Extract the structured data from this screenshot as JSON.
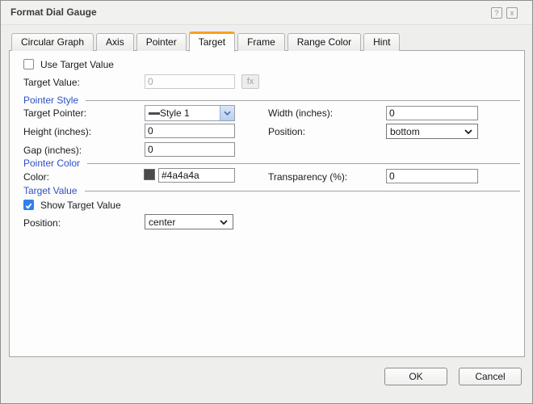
{
  "dialog": {
    "title": "Format Dial Gauge",
    "help_icon": "?",
    "close_icon": "x"
  },
  "tabs": [
    {
      "label": "Circular Graph",
      "selected": false
    },
    {
      "label": "Axis",
      "selected": false
    },
    {
      "label": "Pointer",
      "selected": false
    },
    {
      "label": "Target",
      "selected": true
    },
    {
      "label": "Frame",
      "selected": false
    },
    {
      "label": "Range Color",
      "selected": false
    },
    {
      "label": "Hint",
      "selected": false
    }
  ],
  "general": {
    "use_target_value": {
      "label": "Use Target Value",
      "checked": false
    },
    "target_value": {
      "label": "Target Value:",
      "value": "0",
      "disabled": true,
      "fx_label": "fx"
    }
  },
  "pointer_style": {
    "title": "Pointer Style",
    "target_pointer": {
      "label": "Target Pointer:",
      "value": "Style 1",
      "icon": "line-style"
    },
    "width": {
      "label": "Width (inches):",
      "value": "0"
    },
    "height": {
      "label": "Height (inches):",
      "value": "0"
    },
    "position": {
      "label": "Position:",
      "value": "bottom"
    },
    "gap": {
      "label": "Gap (inches):",
      "value": "0"
    }
  },
  "pointer_color": {
    "title": "Pointer Color",
    "color": {
      "label": "Color:",
      "value": "#4a4a4a",
      "swatch": "#4a4a4a"
    },
    "transparency": {
      "label": "Transparency (%):",
      "value": "0"
    }
  },
  "target_value_section": {
    "title": "Target Value",
    "show_target_value": {
      "label": "Show Target Value",
      "checked": true
    },
    "position": {
      "label": "Position:",
      "value": "center"
    }
  },
  "footer": {
    "ok_label": "OK",
    "cancel_label": "Cancel"
  },
  "colors": {
    "tab_accent_orange": "#f5a21b",
    "section_title_blue": "#2d4fc8",
    "checkbox_blue": "#2f80ed",
    "pointer_color_swatch": "#4a4a4a"
  }
}
